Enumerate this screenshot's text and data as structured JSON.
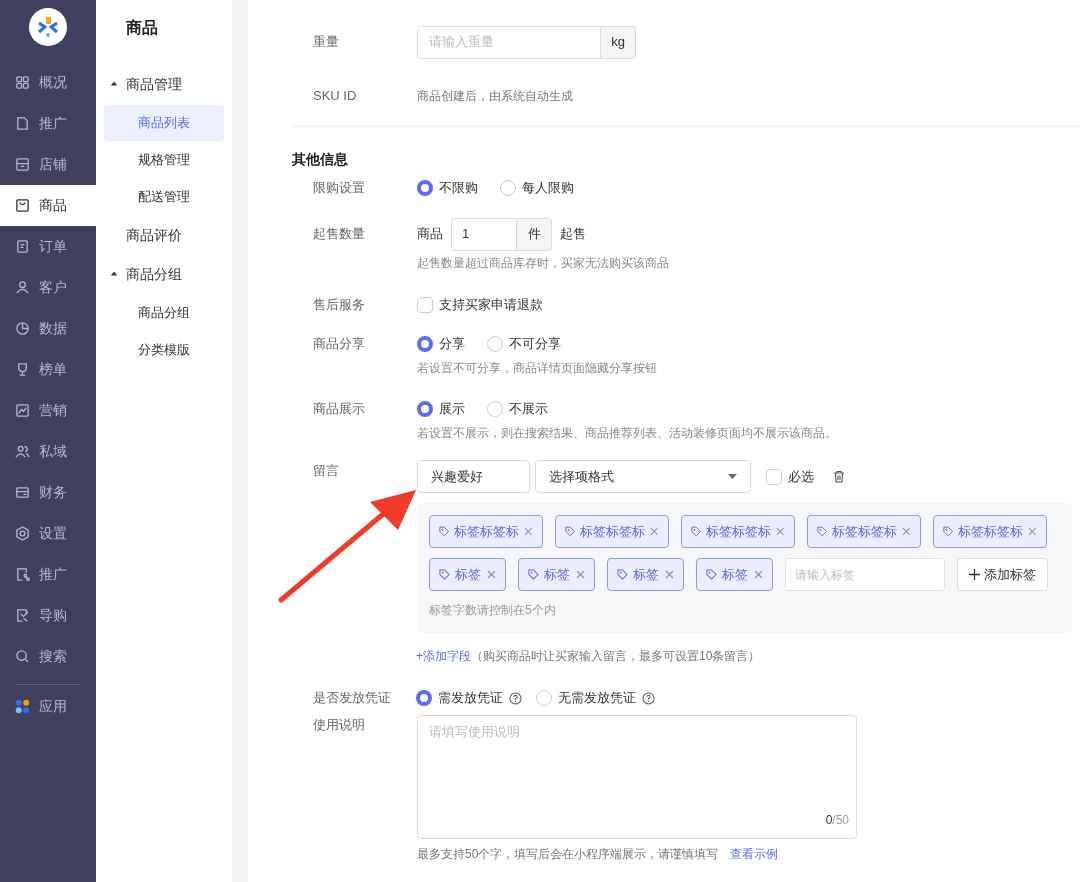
{
  "nav": {
    "items": [
      {
        "label": "概况",
        "selected": false
      },
      {
        "label": "推广",
        "selected": false
      },
      {
        "label": "店铺",
        "selected": false
      },
      {
        "label": "商品",
        "selected": true
      },
      {
        "label": "订单",
        "selected": false
      },
      {
        "label": "客户",
        "selected": false
      },
      {
        "label": "数据",
        "selected": false
      },
      {
        "label": "榜单",
        "selected": false
      },
      {
        "label": "营销",
        "selected": false
      },
      {
        "label": "私域",
        "selected": false
      },
      {
        "label": "财务",
        "selected": false
      },
      {
        "label": "设置",
        "selected": false
      },
      {
        "label": "推广",
        "selected": false
      },
      {
        "label": "导购",
        "selected": false
      },
      {
        "label": "搜索",
        "selected": false
      }
    ],
    "apps": {
      "label": "应用"
    }
  },
  "submenu": {
    "title": "商品",
    "items": [
      {
        "label": "商品管理",
        "expanded": true,
        "children": [
          {
            "label": "商品列表",
            "selected": true
          },
          {
            "label": "规格管理",
            "selected": false
          },
          {
            "label": "配送管理",
            "selected": false
          }
        ]
      },
      {
        "label": "商品评价",
        "selected": false
      },
      {
        "label": "商品分组",
        "expanded": true,
        "children": [
          {
            "label": "商品分组",
            "selected": false
          },
          {
            "label": "分类模版",
            "selected": false
          }
        ]
      }
    ]
  },
  "weight": {
    "label": "重量",
    "placeholder": "请输入重量",
    "unit": "kg"
  },
  "sku": {
    "label": "SKU ID",
    "value": "商品创建后，由系统自动生成"
  },
  "section_title": "其他信息",
  "purchase_limit": {
    "label": "限购设置",
    "options": [
      {
        "label": "不限购",
        "selected": true
      },
      {
        "label": "每人限购",
        "selected": false
      }
    ]
  },
  "min_quantity": {
    "label": "起售数量",
    "prefix": "商品",
    "value": "1",
    "unit": "件",
    "suffix": "起售",
    "hint": "起售数量超过商品库存时，买家无法购买该商品"
  },
  "after_sales": {
    "label": "售后服务",
    "option": "支持买家申请退款",
    "checked": false
  },
  "share": {
    "label": "商品分享",
    "options": [
      {
        "label": "分享",
        "selected": true
      },
      {
        "label": "不可分享",
        "selected": false
      }
    ],
    "hint": "若设置不可分享，商品详情页面隐藏分享按钮"
  },
  "display": {
    "label": "商品展示",
    "options": [
      {
        "label": "展示",
        "selected": true
      },
      {
        "label": "不展示",
        "selected": false
      }
    ],
    "hint": "若设置不展示，则在搜索结果、商品推荐列表、活动装修页面均不展示该商品。"
  },
  "message": {
    "label": "留言",
    "field_name": "兴趣爱好",
    "format": "选择项格式",
    "required_label": "必选",
    "required": false,
    "tags": [
      "标签标签标",
      "标签标签标",
      "标签标签标",
      "标签标签标",
      "标签标签标",
      "标签",
      "标签",
      "标签",
      "标签"
    ],
    "tag_placeholder": "请输入标签",
    "add_tag": "添加标签",
    "tag_hint": "标签字数请控制在5个内",
    "add_field": "+添加字段",
    "add_field_hint": "（购买商品时让买家输入留言，最多可设置10条留言）"
  },
  "voucher": {
    "label": "是否发放凭证",
    "options": [
      {
        "label": "需发放凭证",
        "selected": true
      },
      {
        "label": "无需发放凭证",
        "selected": false
      }
    ]
  },
  "instructions": {
    "label": "使用说明",
    "placeholder": "请填写使用说明",
    "count": "0",
    "limit": "/50",
    "hint": "最多支持50个字，填写后会在小程序端展示，请谨慎填写",
    "link": "查看示例"
  }
}
